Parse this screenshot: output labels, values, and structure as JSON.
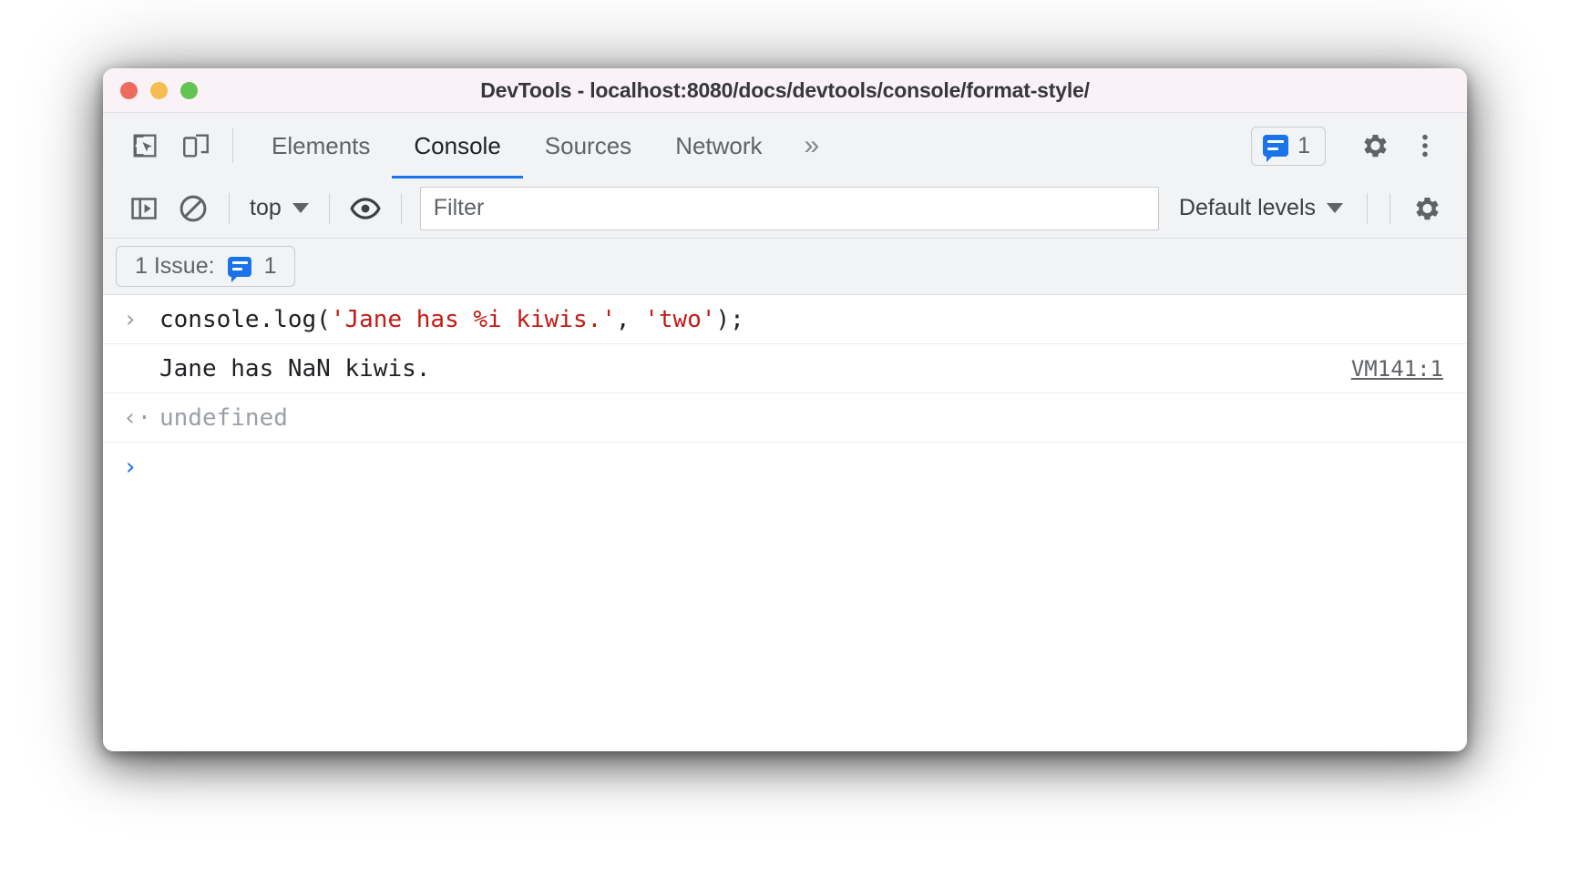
{
  "window": {
    "title": "DevTools - localhost:8080/docs/devtools/console/format-style/",
    "traffic_lights": [
      "close",
      "minimize",
      "zoom"
    ]
  },
  "tabbar": {
    "inspect_icon": "inspect-element-icon",
    "device_icon": "device-toolbar-icon",
    "tabs": [
      {
        "label": "Elements",
        "active": false
      },
      {
        "label": "Console",
        "active": true
      },
      {
        "label": "Sources",
        "active": false
      },
      {
        "label": "Network",
        "active": false
      }
    ],
    "more_tabs_label": "»",
    "issues_count": "1",
    "settings_icon": "gear-icon",
    "more_options_icon": "kebab-menu-icon"
  },
  "console_toolbar": {
    "sidebar_toggle_icon": "console-sidebar-icon",
    "clear_console_icon": "clear-console-icon",
    "context_label": "top",
    "eye_icon": "live-expression-eye-icon",
    "filter_placeholder": "Filter",
    "filter_value": "",
    "levels_label": "Default levels",
    "settings_icon": "console-settings-gear-icon"
  },
  "issues_bar": {
    "label": "1 Issue:",
    "count": "1"
  },
  "console_rows": [
    {
      "type": "input",
      "gutter": "›",
      "segments": [
        {
          "text": "console.log(",
          "style": "plain"
        },
        {
          "text": "'Jane has %i kiwis.'",
          "style": "string"
        },
        {
          "text": ", ",
          "style": "plain"
        },
        {
          "text": "'two'",
          "style": "string"
        },
        {
          "text": ");",
          "style": "plain"
        }
      ],
      "plain_text": "console.log('Jane has %i kiwis.', 'two');"
    },
    {
      "type": "output",
      "gutter": "",
      "text": "Jane has NaN kiwis.",
      "source": "VM141:1"
    },
    {
      "type": "return",
      "gutter": "‹·",
      "text": "undefined"
    },
    {
      "type": "prompt",
      "gutter": "›",
      "text": ""
    }
  ],
  "colors": {
    "accent_blue": "#1a73e8",
    "string_red": "#c41a16",
    "toolbar_bg": "#f1f3f4",
    "titlebar_bg": "#faf2f7",
    "muted_text": "#9aa0a6"
  }
}
